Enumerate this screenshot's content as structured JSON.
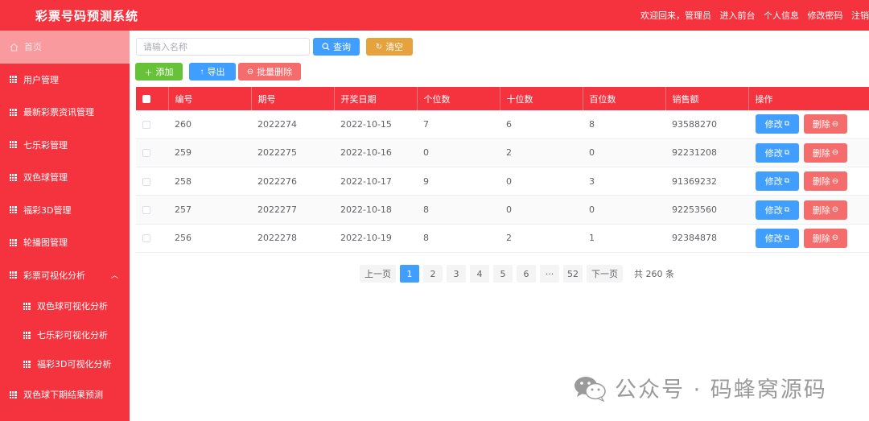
{
  "header": {
    "title": "彩票号码预测系统",
    "welcome": "欢迎回来，管理员",
    "links": [
      "进入前台",
      "个人信息",
      "修改密码",
      "注销"
    ]
  },
  "sidebar": {
    "items": [
      {
        "label": "首页"
      },
      {
        "label": "用户管理"
      },
      {
        "label": "最新彩票资讯管理"
      },
      {
        "label": "七乐彩管理"
      },
      {
        "label": "双色球管理"
      },
      {
        "label": "福彩3D管理"
      },
      {
        "label": "轮播图管理"
      },
      {
        "label": "彩票可视化分析"
      },
      {
        "label": "双色球可视化分析"
      },
      {
        "label": "七乐彩可视化分析"
      },
      {
        "label": "福彩3D可视化分析"
      },
      {
        "label": "双色球下期结果预测"
      }
    ]
  },
  "toolbar": {
    "search_placeholder": "请输入名称",
    "query_label": "查询",
    "clear_label": "清空",
    "add_label": "添加",
    "export_label": "导出",
    "batch_delete_label": "批量删除"
  },
  "table": {
    "headers": [
      "编号",
      "期号",
      "开奖日期",
      "个位数",
      "十位数",
      "百位数",
      "销售额",
      "操作"
    ],
    "rows": [
      [
        "260",
        "2022274",
        "2022-10-15",
        "7",
        "6",
        "8",
        "93588270"
      ],
      [
        "259",
        "2022275",
        "2022-10-16",
        "0",
        "2",
        "0",
        "92231208"
      ],
      [
        "258",
        "2022276",
        "2022-10-17",
        "9",
        "0",
        "3",
        "91369232"
      ],
      [
        "257",
        "2022277",
        "2022-10-18",
        "8",
        "0",
        "0",
        "92253560"
      ],
      [
        "256",
        "2022278",
        "2022-10-19",
        "8",
        "2",
        "1",
        "92384878"
      ]
    ],
    "edit_label": "修改",
    "delete_label": "删除"
  },
  "pagination": {
    "prev": "上一页",
    "pages": [
      "1",
      "2",
      "3",
      "4",
      "5",
      "6",
      "···",
      "52"
    ],
    "next": "下一页",
    "total": "共 260 条",
    "current": "1"
  },
  "watermark": {
    "text": "公众号 · 码蜂窝源码"
  },
  "colors": {
    "primary_red": "#f5333f",
    "blue": "#409eff",
    "green": "#67c23a",
    "orange": "#e6a23c",
    "light_red": "#f56c6c"
  }
}
